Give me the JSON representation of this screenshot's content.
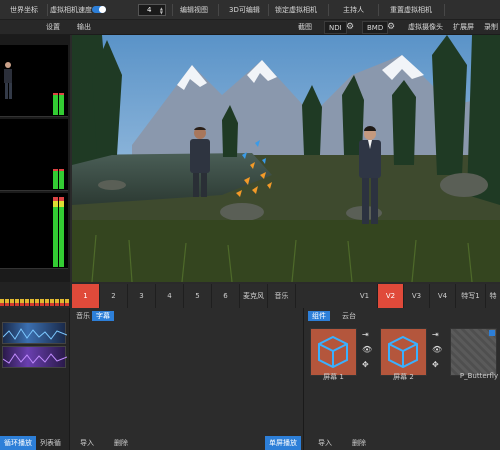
{
  "toolbar": {
    "world_coords": "世界坐标",
    "virtual_camera_speed": "虚拟相机速度",
    "speed_value": "4",
    "edit_view": "编辑视图",
    "edit_3d": "3D可编辑",
    "lock_virtual_camera": "锁定虚拟相机",
    "host": "主持人",
    "reset_virtual_camera": "重置虚拟相机"
  },
  "toolbar2": {
    "settings": "设置",
    "output": "输出",
    "screenshot": "截图",
    "ndi": "NDI",
    "bmd": "BMD",
    "virtual_camera": "虚拟摄像头",
    "extended_screen": "扩展屏",
    "recording_truncated": "录制"
  },
  "scene_tabs": {
    "numbers": [
      "1",
      "2",
      "3",
      "4",
      "5",
      "6"
    ],
    "microphone": "麦克风",
    "music": "音乐",
    "views": [
      "V1",
      "V2",
      "V3",
      "V4"
    ],
    "effect": "特写1",
    "effect_truncated": "特"
  },
  "mid_panel": {
    "tab_music": "音乐",
    "tab_subtitle": "字幕",
    "foot_import": "导入",
    "foot_delete": "删除",
    "foot_single_loop": "单屏播放"
  },
  "left_panel": {
    "foot_loop_play": "循环播放",
    "foot_list_loop": "列表循环"
  },
  "right_panel": {
    "tab_component": "组件",
    "tab_cloud": "云台",
    "cards": [
      {
        "label": "屏幕 1"
      },
      {
        "label": "屏幕 2"
      },
      {
        "label": "P_Butterfly"
      }
    ],
    "foot_import": "导入",
    "foot_delete": "删除"
  },
  "colors": {
    "accent_blue": "#2d7fd8",
    "accent_red": "#e04a3a",
    "card_orange": "#b4563c"
  }
}
